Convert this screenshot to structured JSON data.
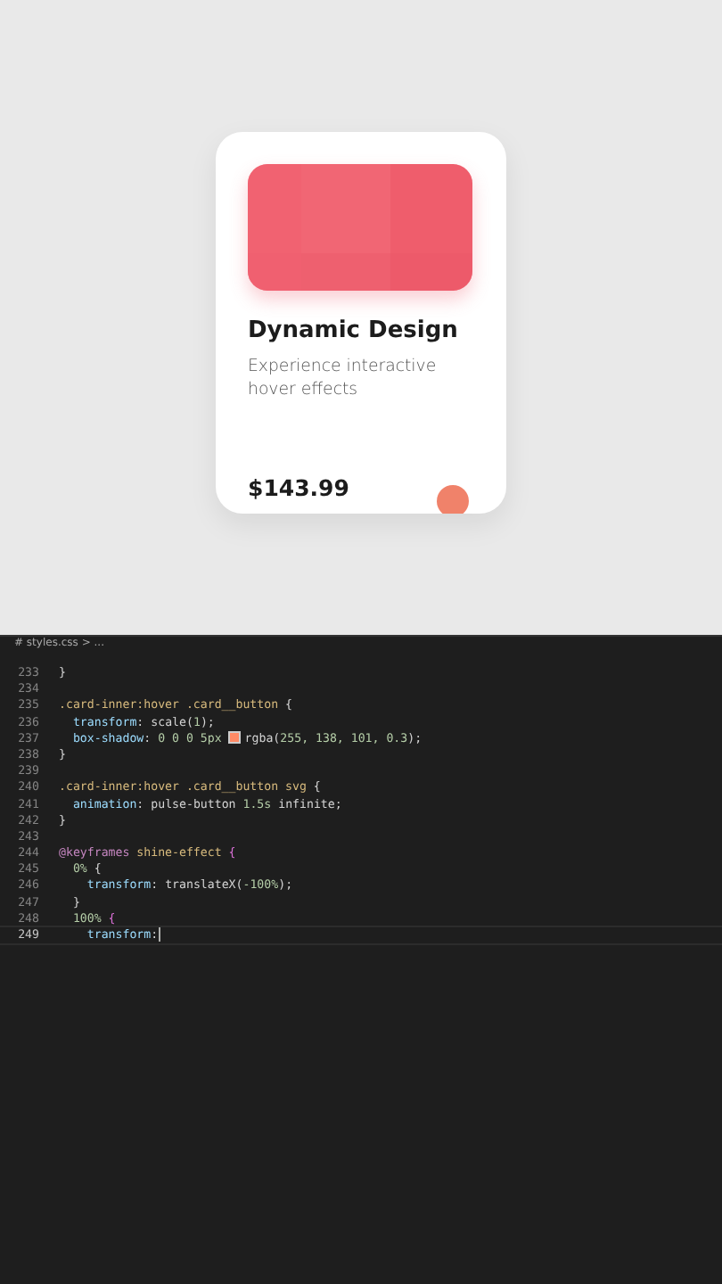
{
  "card": {
    "title": "Dynamic Design",
    "description": "Experience interactive hover effects",
    "price": "$143.99"
  },
  "editor": {
    "breadcrumb": "# styles.css > ...",
    "lines": [
      {
        "number": "233",
        "tokens": [
          {
            "kind": "punct",
            "text": "}"
          }
        ]
      },
      {
        "number": "234"
      },
      {
        "number": "235",
        "tokens": [
          {
            "kind": "sel",
            "text": ".card-inner:hover .card__button"
          },
          {
            "kind": "punct",
            "text": " {"
          }
        ]
      },
      {
        "number": "236",
        "tokens": [
          {
            "kind": "prop",
            "text": "  transform"
          },
          {
            "kind": "punct",
            "text": ": "
          },
          {
            "kind": "val",
            "text": "scale("
          },
          {
            "kind": "num",
            "text": "1"
          },
          {
            "kind": "val",
            "text": ");"
          }
        ]
      },
      {
        "number": "237",
        "tokens": [
          {
            "kind": "prop",
            "text": "  box-shadow"
          },
          {
            "kind": "punct",
            "text": ": "
          },
          {
            "kind": "num",
            "text": "0 0 0 5px "
          },
          {
            "kind": "swatch",
            "color": "#ff8a65"
          },
          {
            "kind": "val",
            "text": "rgba("
          },
          {
            "kind": "num",
            "text": "255, 138, 101, 0.3"
          },
          {
            "kind": "val",
            "text": ");"
          }
        ]
      },
      {
        "number": "238",
        "tokens": [
          {
            "kind": "punct",
            "text": "}"
          }
        ]
      },
      {
        "number": "239"
      },
      {
        "number": "240",
        "tokens": [
          {
            "kind": "sel",
            "text": ".card-inner:hover .card__button svg"
          },
          {
            "kind": "punct",
            "text": " {"
          }
        ]
      },
      {
        "number": "241",
        "tokens": [
          {
            "kind": "prop",
            "text": "  animation"
          },
          {
            "kind": "punct",
            "text": ": "
          },
          {
            "kind": "val",
            "text": "pulse-button "
          },
          {
            "kind": "num",
            "text": "1.5s"
          },
          {
            "kind": "val",
            "text": " infinite;"
          }
        ]
      },
      {
        "number": "242",
        "tokens": [
          {
            "kind": "punct",
            "text": "}"
          }
        ]
      },
      {
        "number": "243"
      },
      {
        "number": "244",
        "tokens": [
          {
            "kind": "at",
            "text": "@keyframes"
          },
          {
            "kind": "sel",
            "text": " shine-effect"
          },
          {
            "kind": "brace",
            "text": " {"
          }
        ]
      },
      {
        "number": "245",
        "tokens": [
          {
            "kind": "num",
            "text": "  0%"
          },
          {
            "kind": "punct",
            "text": " {"
          }
        ]
      },
      {
        "number": "246",
        "tokens": [
          {
            "kind": "prop",
            "text": "    transform"
          },
          {
            "kind": "punct",
            "text": ": "
          },
          {
            "kind": "val",
            "text": "translateX("
          },
          {
            "kind": "num",
            "text": "-100%"
          },
          {
            "kind": "val",
            "text": ");"
          }
        ]
      },
      {
        "number": "247",
        "tokens": [
          {
            "kind": "punct",
            "text": "  }"
          }
        ]
      },
      {
        "number": "248",
        "tokens": [
          {
            "kind": "num",
            "text": "  100%"
          },
          {
            "kind": "brace",
            "text": " {"
          }
        ]
      },
      {
        "number": "249",
        "tokens": [
          {
            "kind": "prop",
            "text": "    transform"
          },
          {
            "kind": "punct",
            "text": ":"
          }
        ],
        "selected": true
      }
    ]
  }
}
